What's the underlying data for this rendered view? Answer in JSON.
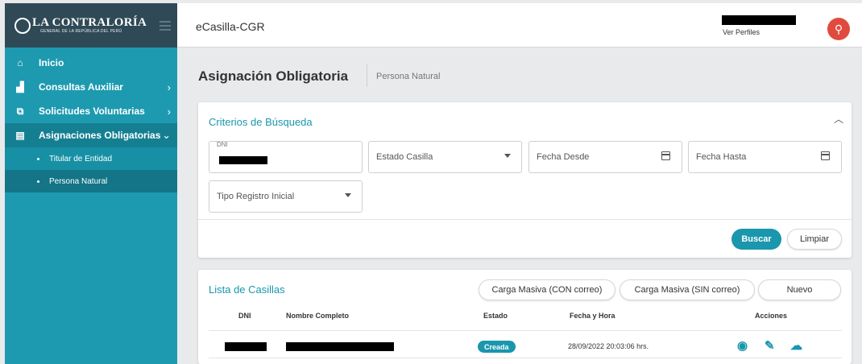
{
  "sidebar": {
    "logo_main": "LA CONTRALORÍA",
    "logo_sub": "GENERAL DE LA REPÚBLICA DEL PERÚ",
    "items": [
      {
        "label": "Inicio",
        "icon": "home-icon"
      },
      {
        "label": "Consultas Auxiliar",
        "icon": "bar-chart-icon"
      },
      {
        "label": "Solicitudes Voluntarias",
        "icon": "copy-icon"
      },
      {
        "label": "Asignaciones Obligatorias",
        "icon": "assignment-icon"
      }
    ],
    "subitems": [
      {
        "label": "Titular de Entidad"
      },
      {
        "label": "Persona Natural"
      }
    ]
  },
  "header": {
    "app_title": "eCasilla-CGR",
    "profiles_link": "Ver Perfiles"
  },
  "page": {
    "title": "Asignación Obligatoria",
    "subtitle": "Persona Natural"
  },
  "search": {
    "title": "Criterios de Búsqueda",
    "dni_label": "DNI",
    "estado_label": "Estado Casilla",
    "fecha_desde_label": "Fecha Desde",
    "fecha_hasta_label": "Fecha Hasta",
    "tipo_registro_label": "Tipo Registro Inicial",
    "buscar_label": "Buscar",
    "limpiar_label": "Limpiar"
  },
  "list": {
    "title": "Lista de Casillas",
    "btn_con_correo": "Carga Masiva (CON correo)",
    "btn_sin_correo": "Carga Masiva (SIN correo)",
    "btn_nuevo": "Nuevo",
    "columns": [
      "DNI",
      "Nombre Completo",
      "Estado",
      "Fecha y Hora",
      "Acciones"
    ],
    "rows": [
      {
        "estado": "Creada",
        "fecha": "28/09/2022 20:03:06 hrs."
      }
    ]
  },
  "colors": {
    "accent": "#1a96ad",
    "sidebar": "#1d9ab0",
    "logo_bar": "#2f4a56",
    "avatar": "#e14b3f"
  }
}
